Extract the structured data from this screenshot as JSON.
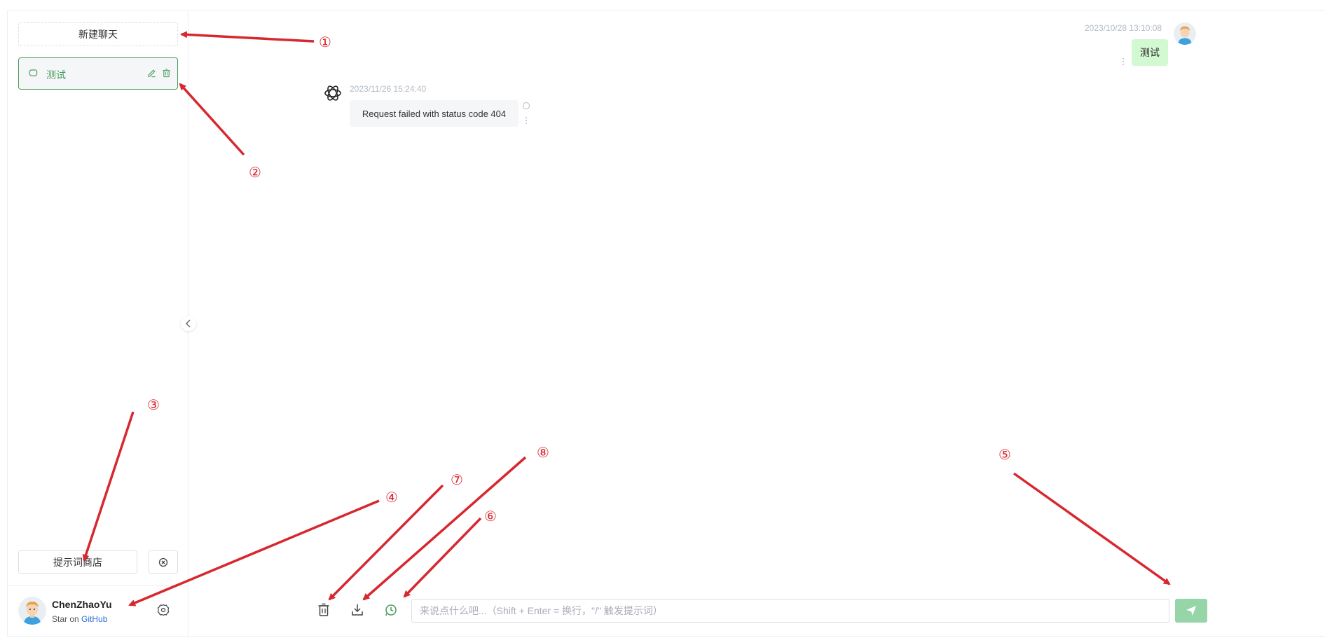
{
  "sidebar": {
    "new_chat_label": "新建聊天",
    "conversation": {
      "title": "测试"
    },
    "prompt_store_label": "提示词商店",
    "user": {
      "name": "ChenZhaoYu",
      "star_text": "Star on ",
      "github_text": "GitHub"
    }
  },
  "messages": {
    "user": {
      "time": "2023/10/28 13:10:08",
      "text": "测试"
    },
    "assistant": {
      "time": "2023/11/26 15:24:40",
      "text": "Request failed with status code 404"
    }
  },
  "composer": {
    "placeholder": "来说点什么吧...（Shift + Enter = 换行，\"/\" 触发提示词）"
  },
  "annotations": [
    "①",
    "②",
    "③",
    "④",
    "⑤",
    "⑥",
    "⑦",
    "⑧"
  ],
  "colors": {
    "accent": "#4b9e5f",
    "user_bubble": "#d2f9d1",
    "send_button": "#95d5a8",
    "annotation": "#d7282f"
  }
}
